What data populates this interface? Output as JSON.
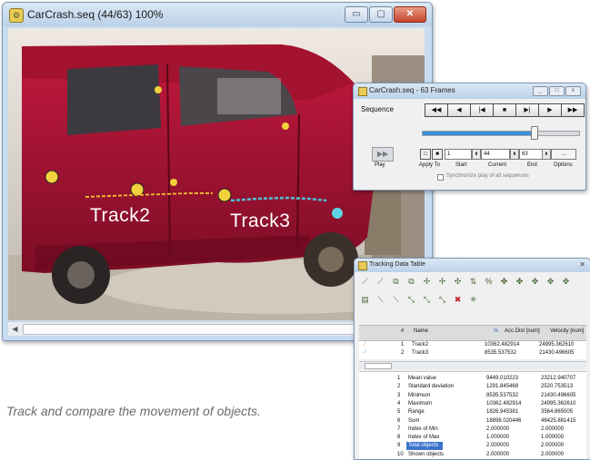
{
  "main_window": {
    "title": "CarCrash.seq (44/63) 100%",
    "buttons": {
      "minimize": "▭",
      "maximize": "▢",
      "close": "✕"
    },
    "track_labels": [
      "Track2",
      "Track3"
    ]
  },
  "sequence_window": {
    "title": "CarCrash.seq - 63 Frames",
    "sequence_label": "Sequence",
    "transport": [
      "◀◀",
      "◀",
      "|◀",
      "■",
      "▶|",
      "▶",
      "▶▶"
    ],
    "slider_position": 0.71,
    "play_label": "Play",
    "apply_to_label": "Apply To",
    "start_label": "Start",
    "current_label": "Current",
    "end_label": "End",
    "options_label": "Options",
    "start_value": "1",
    "current_value": "44",
    "end_value": "63",
    "sync_label": "Synchronize play of all sequences"
  },
  "tracking_table": {
    "title": "Tracking Data Table",
    "columns": {
      "index": "#",
      "name": "Name",
      "acc_dist": "Acc.Dist [num]",
      "velocity": "Velocity [num]"
    },
    "tracks": [
      {
        "index": "1",
        "name": "Track2",
        "acc_dist": "10362.482914",
        "velocity": "24995.362610"
      },
      {
        "index": "2",
        "name": "Track3",
        "acc_dist": "8535.537532",
        "velocity": "21430.496605"
      }
    ],
    "stats": [
      {
        "index": "1",
        "label": "Mean value",
        "acc_dist": "9449.010223",
        "velocity": "23212.940707"
      },
      {
        "index": "2",
        "label": "Standard deviation",
        "acc_dist": "1291.845468",
        "velocity": "2520.753513"
      },
      {
        "index": "3",
        "label": "Minimum",
        "acc_dist": "8535.537532",
        "velocity": "21430.496605"
      },
      {
        "index": "4",
        "label": "Maximum",
        "acc_dist": "10362.482914",
        "velocity": "24995.362610"
      },
      {
        "index": "5",
        "label": "Range",
        "acc_dist": "1826.945381",
        "velocity": "3564.865005"
      },
      {
        "index": "6",
        "label": "Sum",
        "acc_dist": "18898.020446",
        "velocity": "46425.881415"
      },
      {
        "index": "7",
        "label": "Index of Min",
        "acc_dist": "2.000000",
        "velocity": "2.000000"
      },
      {
        "index": "8",
        "label": "Index of Max",
        "acc_dist": "1.000000",
        "velocity": "1.000000"
      },
      {
        "index": "9",
        "label": "Total objects",
        "acc_dist": "2.000000",
        "velocity": "2.000000"
      },
      {
        "index": "10",
        "label": "Shown objects",
        "acc_dist": "2.000000",
        "velocity": "2.000000"
      }
    ],
    "selected_stat_index": 8
  },
  "caption": "Track and compare the movement of objects."
}
